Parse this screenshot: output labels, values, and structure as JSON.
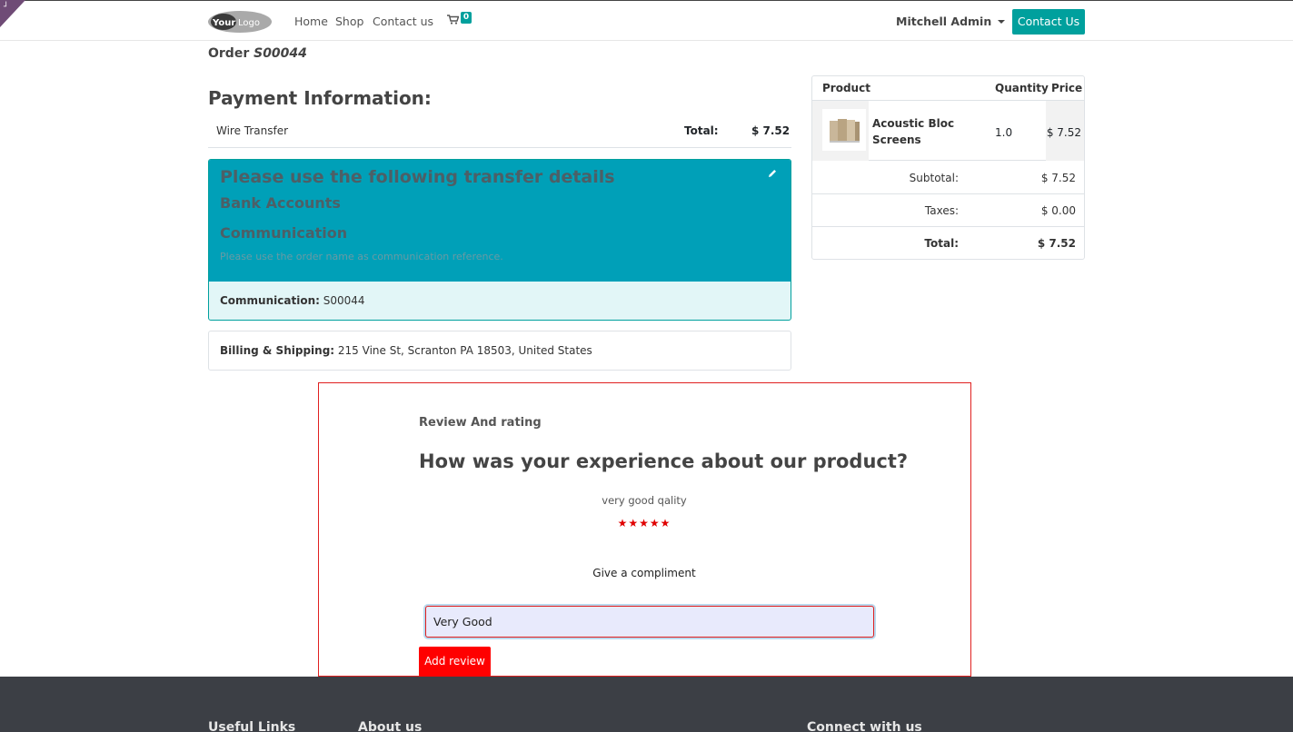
{
  "nav": {
    "logo_text": "YourLogo",
    "links": [
      "Home",
      "Shop",
      "Contact us"
    ],
    "cart_icon": "shopping-cart-icon",
    "cart_count": "0",
    "user": "Mitchell Admin",
    "contact_button": "Contact Us"
  },
  "order": {
    "label": "Order",
    "number": "S00044"
  },
  "payment": {
    "heading": "Payment Information:",
    "method": "Wire Transfer",
    "total_label": "Total:",
    "total_value": "$ 7.52",
    "transfer_title": "Please use the following transfer details",
    "bank_accounts": "Bank Accounts",
    "communication_heading": "Communication",
    "communication_note": "Please use the order name as communication reference.",
    "communication_label": "Communication:",
    "communication_value": "S00044",
    "edit_icon": "pencil-icon"
  },
  "billing": {
    "label": "Billing & Shipping:",
    "address": "215 Vine St, Scranton PA 18503, United States"
  },
  "summary": {
    "headers": {
      "product": "Product",
      "quantity": "Quantity",
      "price": "Price"
    },
    "product": {
      "name": "Acoustic Bloc Screens",
      "quantity": "1.0",
      "price": "$ 7.52"
    },
    "subtotal_label": "Subtotal:",
    "subtotal_value": "$ 7.52",
    "taxes_label": "Taxes:",
    "taxes_value": "$ 0.00",
    "total_label": "Total:",
    "total_value": "$ 7.52"
  },
  "review": {
    "title": "Review And rating",
    "question": "How was your experience about our product?",
    "comment": "very good qality",
    "stars": "★★★★★",
    "rating": 5,
    "rating_max": 5,
    "compliment_label": "Give a compliment",
    "input_value": "Very Good",
    "submit_label": "Add review"
  },
  "footer": {
    "useful_links": "Useful Links",
    "about_us": "About us",
    "connect": "Connect with us"
  },
  "colors": {
    "primary": "#00a09d",
    "transfer_banner": "#00a0b8",
    "review_accent": "#ff0000",
    "footer_bg": "#3c3f45"
  }
}
